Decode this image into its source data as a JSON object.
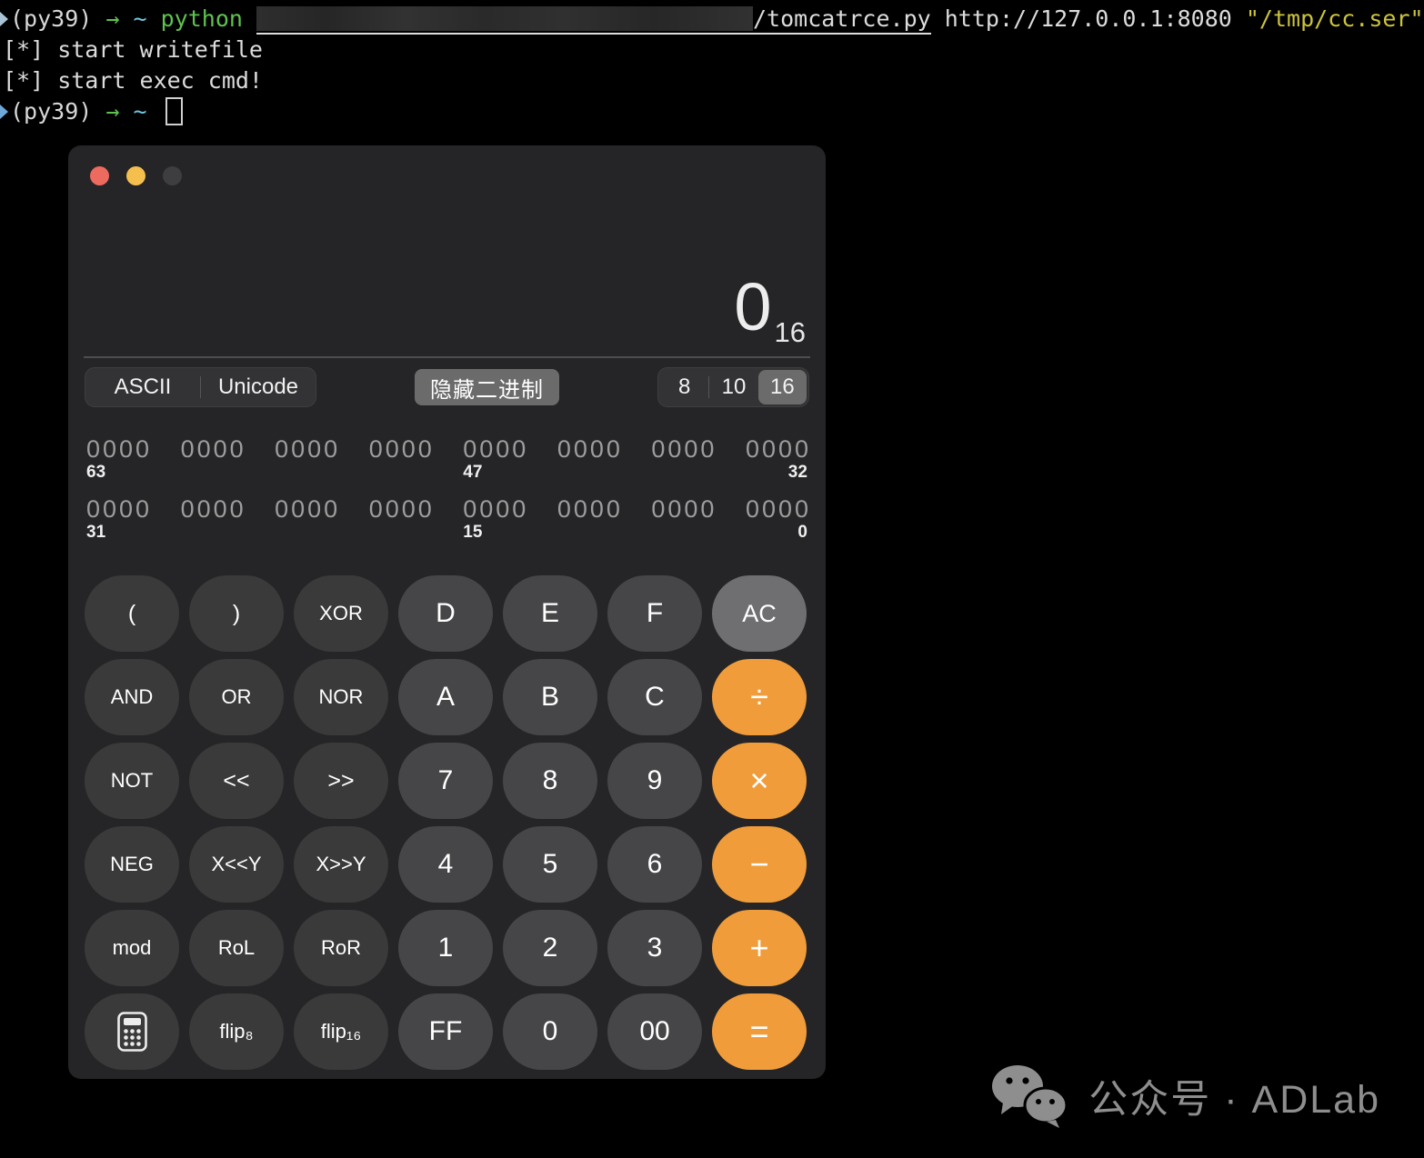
{
  "terminal": {
    "prompt": {
      "venv": "(py39)",
      "arrow": "→",
      "tilde": "~"
    },
    "line1": {
      "command": "python",
      "script_path": "/tomcatrce.py",
      "url": "http://127.0.0.1:8080",
      "arg": "\"/tmp/cc.ser\""
    },
    "line2": "[*] start writefile",
    "line3": "[*] start exec cmd!"
  },
  "calculator": {
    "display": {
      "value": "0",
      "radix": "16"
    },
    "controls": {
      "ascii": "ASCII",
      "unicode": "Unicode",
      "hide_binary": "隐藏二进制",
      "base8": "8",
      "base10": "10",
      "base16": "16",
      "selected_base": "16"
    },
    "binary": {
      "row1": {
        "groups": [
          "0000",
          "0000",
          "0000",
          "0000",
          "0000",
          "0000",
          "0000",
          "0000"
        ],
        "labels": [
          "63",
          "",
          "",
          "",
          "47",
          "",
          "",
          "32"
        ]
      },
      "row2": {
        "groups": [
          "0000",
          "0000",
          "0000",
          "0000",
          "0000",
          "0000",
          "0000",
          "0000"
        ],
        "labels": [
          "31",
          "",
          "",
          "",
          "15",
          "",
          "",
          "0"
        ]
      }
    },
    "keypad": {
      "rows": [
        [
          "(",
          ")",
          "XOR",
          "D",
          "E",
          "F",
          "AC"
        ],
        [
          "AND",
          "OR",
          "NOR",
          "A",
          "B",
          "C",
          "÷"
        ],
        [
          "NOT",
          "<<",
          ">>",
          "7",
          "8",
          "9",
          "×"
        ],
        [
          "NEG",
          "X<<Y",
          "X>>Y",
          "4",
          "5",
          "6",
          "−"
        ],
        [
          "mod",
          "RoL",
          "RoR",
          "1",
          "2",
          "3",
          "+"
        ],
        [
          "",
          "flip₈",
          "flip₁₆",
          "FF",
          "0",
          "00",
          "="
        ]
      ],
      "icon_key": "basic-calculator-keypad-icon"
    }
  },
  "watermark": {
    "text": "公众号 · ADLab",
    "icon": "wechat-icon"
  },
  "colors": {
    "accent_orange": "#f09c3b",
    "traffic_red": "#ed6a5f",
    "traffic_yellow": "#f5bf4e",
    "terminal_green": "#5fc24f",
    "terminal_cyan": "#6cc9de",
    "terminal_yellow": "#cdc33c",
    "window_bg": "#252527"
  }
}
